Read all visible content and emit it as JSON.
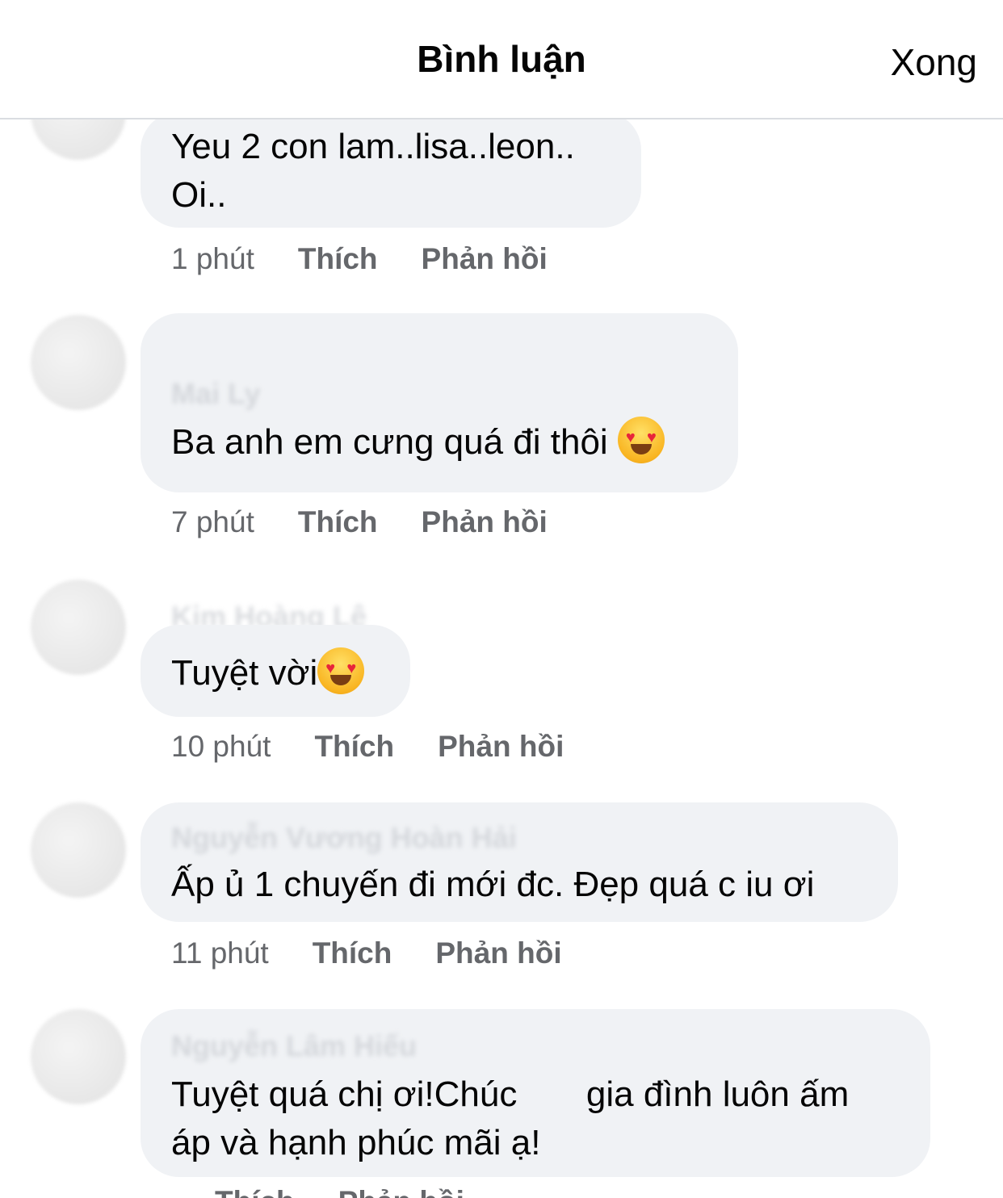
{
  "header": {
    "title": "Bình luận",
    "done_label": "Xong"
  },
  "comments": [
    {
      "author": "",
      "text": "Yeu 2 con lam..lisa..leon..\nOi..",
      "time": "1 phút",
      "like_label": "Thích",
      "reply_label": "Phản hồi"
    },
    {
      "author": "Mai Ly",
      "text": "Ba anh em cưng quá đi thôi ",
      "emoji": "smiling-face-with-heart-eyes",
      "time": "7 phút",
      "like_label": "Thích",
      "reply_label": "Phản hồi"
    },
    {
      "author": "Kim Hoàng Lê",
      "text": "Tuyệt vời",
      "emoji": "smiling-face-with-heart-eyes",
      "time": "10 phút",
      "like_label": "Thích",
      "reply_label": "Phản hồi"
    },
    {
      "author": "Nguyễn Vương Hoàn Hải",
      "text": "Ấp ủ 1 chuyến đi mới đc. Đẹp quá c iu ơi",
      "time": "11 phút",
      "like_label": "Thích",
      "reply_label": "Phản hồi"
    },
    {
      "author": "Nguyễn Lâm Hiếu",
      "text": "Tuyệt quá chị ơi!Chúc       gia đình luôn ấm\náp và hạnh phúc mãi ạ!",
      "time": "",
      "like_label": "Thích",
      "reply_label": "Phản hồi"
    }
  ],
  "colors": {
    "bubble": "#f0f2f5",
    "meta": "#65676b",
    "text": "#050505"
  }
}
